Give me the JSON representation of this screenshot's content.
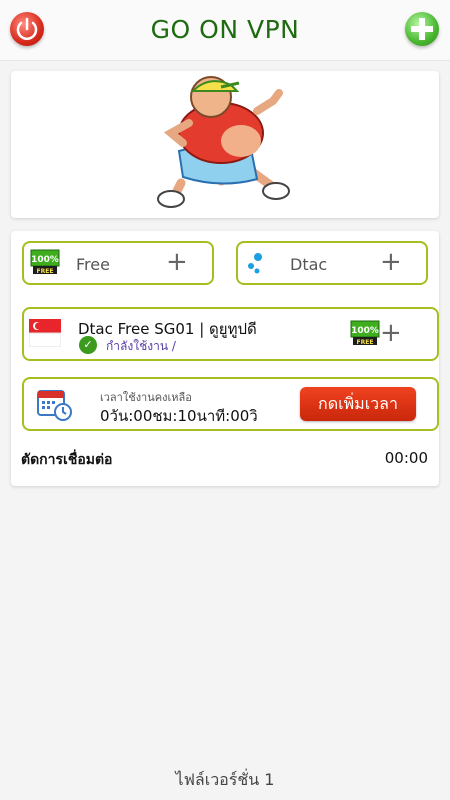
{
  "header": {
    "title": "GO ON VPN"
  },
  "options": {
    "free": {
      "label": "Free",
      "plus": "+"
    },
    "dtac": {
      "label": "Dtac",
      "plus": "+"
    }
  },
  "server": {
    "name": "Dtac Free SG01 | ดูยูทูปดี",
    "status": "กำลังใช้งาน /",
    "plus": "+"
  },
  "time": {
    "label": "เวลาใช้งานคงเหลือ",
    "value": "0วัน:00ชม:10นาที:00วิ",
    "add_button": "กดเพิ่มเวลา"
  },
  "disconnect": {
    "label": "ตัดการเชื่อมต่อ",
    "value": "00:00"
  },
  "footer": {
    "server_file": "ไฟล์เวอร์ชั่น 1"
  },
  "badges": {
    "percent": "100%",
    "free": "FREE"
  },
  "colors": {
    "accent": "#a8bd1f",
    "title": "#1f6b12",
    "button": "#e0381a"
  }
}
